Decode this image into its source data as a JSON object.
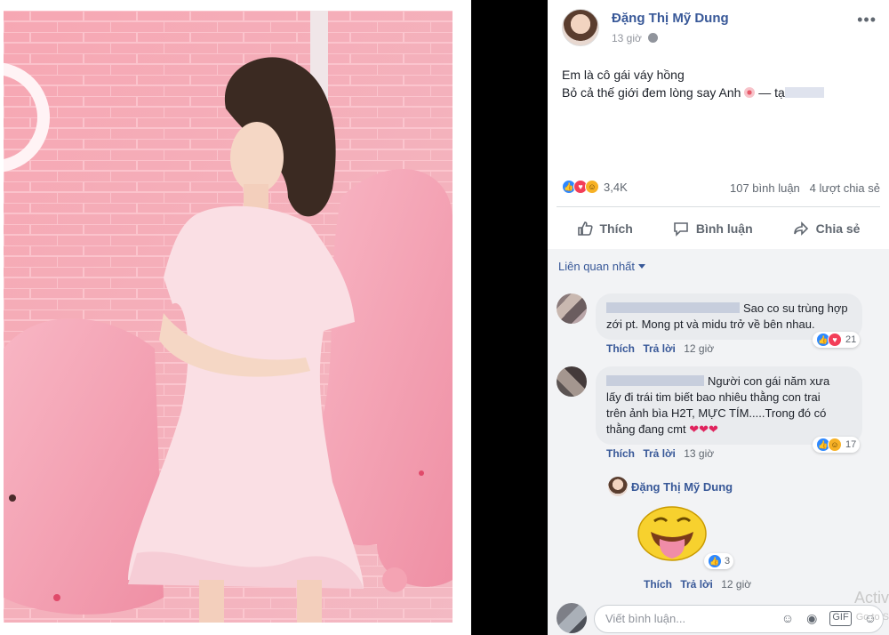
{
  "post": {
    "author": "Đặng Thị Mỹ Dung",
    "time": "13 giờ",
    "line1": "Em là cô gái váy hồng",
    "line2": "Bỏ cả thế giới đem lòng say Anh",
    "tag_prefix": "— tạ",
    "reaction_count": "3,4K",
    "comments_count": "107 bình luận",
    "shares_count": "4 lượt chia sẻ",
    "like_label": "Thích",
    "comment_label": "Bình luận",
    "share_label": "Chia sẻ"
  },
  "comments_section": {
    "sort_label": "Liên quan nhất",
    "comments": [
      {
        "text_line1": "Sao co su trùng hợp",
        "text_line2": "zới pt. Mong pt và midu trở về bên nhau.",
        "like": "Thích",
        "reply": "Trả lời",
        "time": "12 giờ",
        "reactions": "21"
      },
      {
        "text_line1": "Người con gái năm xưa",
        "text_line2": "lấy đi trái tim biết bao nhiêu thằng con trai",
        "text_line3": "trên ảnh bìa H2T, MỰC TÍM.....Trong đó có",
        "text_line4": "thằng đang cmt",
        "hearts": "❤❤❤",
        "like": "Thích",
        "reply": "Trả lời",
        "time": "13 giờ",
        "reactions": "17"
      }
    ],
    "reply": {
      "author": "Đặng Thị Mỹ Dung",
      "reactions": "3",
      "like": "Thích",
      "reply": "Trả lời",
      "time": "12 giờ"
    },
    "input_placeholder": "Viết bình luận..."
  },
  "watermark": {
    "line1": "Activ",
    "line2": "Go to S"
  },
  "icons": {
    "more": "more-icon",
    "globe": "globe-icon",
    "like": "like-icon",
    "comment": "comment-icon",
    "share": "share-icon",
    "emoji": "emoji-icon",
    "camera": "camera-icon",
    "gif": "gif-icon",
    "sticker": "sticker-icon"
  },
  "colors": {
    "link": "#385898",
    "photo_bg": "#f7b8c4"
  }
}
